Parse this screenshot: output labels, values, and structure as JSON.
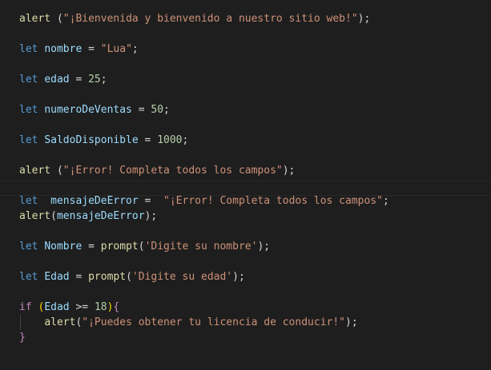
{
  "code": {
    "l1": {
      "fn": "alert",
      "p1": " (",
      "str": "\"¡Bienvenida y bienvenido a nuestro sitio web!\"",
      "p2": ");"
    },
    "l2": {
      "kw": "let",
      "p0": " ",
      "var": "nombre",
      "p1": " = ",
      "str": "\"Lua\"",
      "p2": ";"
    },
    "l3": {
      "kw": "let",
      "p0": " ",
      "var": "edad",
      "p1": " = ",
      "num": "25",
      "p2": ";"
    },
    "l4": {
      "kw": "let",
      "p0": " ",
      "var": "numeroDeVentas",
      "p1": " = ",
      "num": "50",
      "p2": ";"
    },
    "l5": {
      "kw": "let",
      "p0": " ",
      "var": "SaldoDisponible",
      "p1": " = ",
      "num": "1000",
      "p2": ";"
    },
    "l6": {
      "fn": "alert",
      "p1": " (",
      "str": "\"¡Error! Completa todos los campos\"",
      "p2": ");"
    },
    "l7": {
      "kw": "let",
      "p0": "  ",
      "var": "mensajeDeError",
      "p1": " =  ",
      "str": "\"¡Error! Completa todos los campos\"",
      "p2": ";"
    },
    "l8": {
      "fn": "alert",
      "p1": "(",
      "var": "mensajeDeError",
      "p2": ");"
    },
    "l9": {
      "kw": "let",
      "p0": " ",
      "var": "Nombre",
      "p1": " = ",
      "fn": "prompt",
      "p2": "(",
      "str": "'Digite su nombre'",
      "p3": ");"
    },
    "l10": {
      "kw": "let",
      "p0": " ",
      "var": "Edad",
      "p1": " = ",
      "fn": "prompt",
      "p2": "(",
      "str": "'Digite su edad'",
      "p3": ");"
    },
    "l11": {
      "ctl": "if",
      "p0": " ",
      "open": "(",
      "var": "Edad",
      "p1": " >= ",
      "num": "18",
      "close": ")",
      "brace": "{"
    },
    "l12": {
      "indent": "    ",
      "fn": "alert",
      "p1": "(",
      "str": "\"¡Puedes obtener tu licencia de conducir!\"",
      "p2": ");"
    },
    "l13": {
      "brace": "}"
    }
  }
}
